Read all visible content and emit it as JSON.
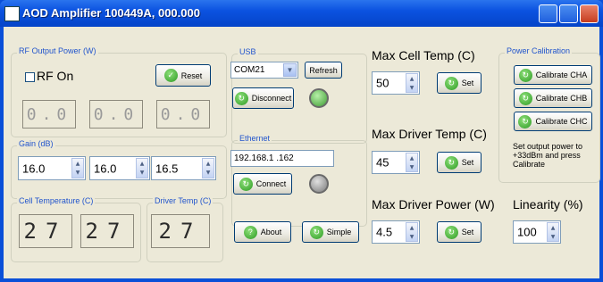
{
  "window": {
    "title": "AOD Amplifier 100449A, 000.000"
  },
  "rf_power": {
    "group_label": "RF Output Power (W)",
    "rf_on_label": "RF On",
    "rf_on_checked": false,
    "reset_label": "Reset",
    "displays": [
      "0.0",
      "0.0",
      "0.0"
    ]
  },
  "gain": {
    "group_label": "Gain (dB)",
    "values": [
      "16.0",
      "16.0",
      "16.5"
    ]
  },
  "cell_temp": {
    "group_label": "Cell Temperature (C)",
    "displays": [
      "27",
      "27"
    ]
  },
  "driver_temp": {
    "group_label": "Driver Temp (C)",
    "display": "27"
  },
  "usb": {
    "group_label": "USB",
    "port": "COM21",
    "refresh_label": "Refresh",
    "disconnect_label": "Disconnect",
    "led_color": "#3f9c34"
  },
  "ethernet": {
    "group_label": "Ethernet",
    "ip": "192.168.1  .162",
    "connect_label": "Connect",
    "led_color": "#7a7a7a"
  },
  "about_label": "About",
  "simple_label": "Simple",
  "max_cell_temp": {
    "label": "Max Cell Temp (C)",
    "value": "50",
    "set_label": "Set"
  },
  "max_driver_temp": {
    "label": "Max Driver Temp (C)",
    "value": "45",
    "set_label": "Set"
  },
  "max_driver_power": {
    "label": "Max Driver Power  (W)",
    "value": "4.5",
    "set_label": "Set"
  },
  "linearity": {
    "label": "Linearity (%)",
    "value": "100"
  },
  "power_cal": {
    "group_label": "Power Calibration",
    "buttons": [
      "Calibrate CHA",
      "Calibrate CHB",
      "Calibrate CHC"
    ],
    "note": "Set output power to +33dBm and press Calibrate"
  },
  "icons": {
    "title": "app-icon",
    "button": "green-circle-arrow-icon",
    "ok": "green-check-icon",
    "help": "question-icon"
  }
}
